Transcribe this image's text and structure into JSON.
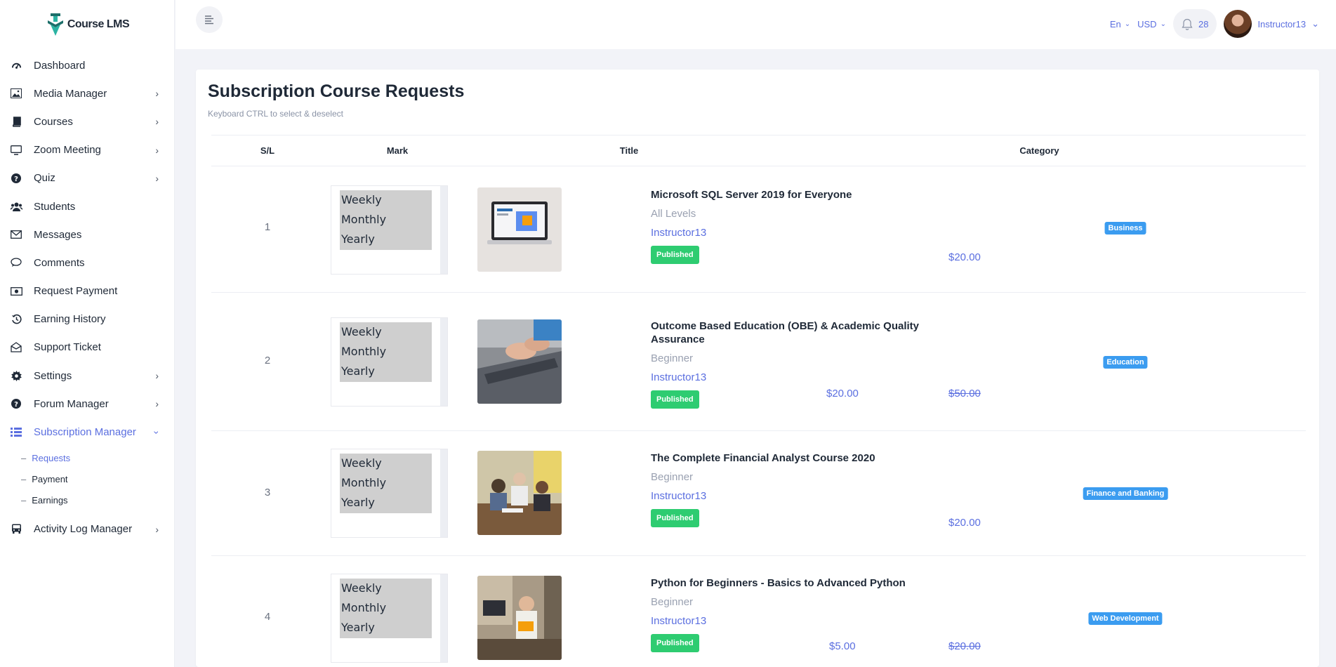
{
  "app": {
    "logo_text": "Course LMS"
  },
  "sidebar": {
    "items": [
      {
        "label": "Dashboard",
        "icon": "dashboard-icon",
        "has_children": false
      },
      {
        "label": "Media Manager",
        "icon": "image-icon",
        "has_children": true
      },
      {
        "label": "Courses",
        "icon": "book-icon",
        "has_children": true
      },
      {
        "label": "Zoom Meeting",
        "icon": "monitor-icon",
        "has_children": true
      },
      {
        "label": "Quiz",
        "icon": "question-icon",
        "has_children": true
      },
      {
        "label": "Students",
        "icon": "users-icon",
        "has_children": false
      },
      {
        "label": "Messages",
        "icon": "envelope-icon",
        "has_children": false
      },
      {
        "label": "Comments",
        "icon": "comments-icon",
        "has_children": false
      },
      {
        "label": "Request Payment",
        "icon": "money-icon",
        "has_children": false
      },
      {
        "label": "Earning History",
        "icon": "history-icon",
        "has_children": false
      },
      {
        "label": "Support Ticket",
        "icon": "envelope-open-icon",
        "has_children": false
      },
      {
        "label": "Settings",
        "icon": "gear-icon",
        "has_children": true
      },
      {
        "label": "Forum Manager",
        "icon": "question-icon",
        "has_children": true
      },
      {
        "label": "Subscription Manager",
        "icon": "list-icon",
        "has_children": true,
        "active": true
      },
      {
        "label": "Activity Log Manager",
        "icon": "bus-icon",
        "has_children": true
      }
    ],
    "submenu": [
      {
        "label": "Requests",
        "current": true
      },
      {
        "label": "Payment"
      },
      {
        "label": "Earnings"
      }
    ]
  },
  "topbar": {
    "language": "En",
    "currency": "USD",
    "notification_count": "28",
    "username": "Instructor13"
  },
  "page": {
    "title": "Subscription Course Requests",
    "subtitle": "Keyboard CTRL to select & deselect"
  },
  "table": {
    "headers": {
      "sl": "S/L",
      "mark": "Mark",
      "title": "Title",
      "category": "Category"
    },
    "select_options": [
      "Weekly",
      "Monthly",
      "Yearly"
    ],
    "rows": [
      {
        "sl": "1",
        "title": "Microsoft SQL Server 2019 for Everyone",
        "level": "All Levels",
        "instructor": "Instructor13",
        "status": "Published",
        "price": "$20.00",
        "old_price": "",
        "category": "Business"
      },
      {
        "sl": "2",
        "title": "Outcome Based Education (OBE) & Academic Quality Assurance",
        "level": "Beginner",
        "instructor": "Instructor13",
        "status": "Published",
        "price": "$20.00",
        "old_price": "$50.00",
        "category": "Education"
      },
      {
        "sl": "3",
        "title": "The Complete Financial Analyst Course 2020",
        "level": "Beginner",
        "instructor": "Instructor13",
        "status": "Published",
        "price": "$20.00",
        "old_price": "",
        "category": "Finance and Banking"
      },
      {
        "sl": "4",
        "title": "Python for Beginners - Basics to Advanced Python",
        "level": "Beginner",
        "instructor": "Instructor13",
        "status": "Published",
        "price": "$5.00",
        "old_price": "$20.00",
        "category": "Web Development"
      }
    ]
  },
  "colors": {
    "accent": "#5b6fe0",
    "published": "#2ecc71",
    "category_badge": "#3b9cf0"
  }
}
